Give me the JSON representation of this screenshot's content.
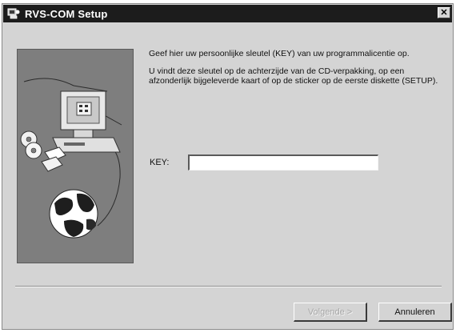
{
  "window": {
    "title": "RVS-COM Setup",
    "close_glyph": "✕",
    "app_icon": "setup-icon"
  },
  "side_panel": {
    "illustration": "computer-cd-globe-illustration"
  },
  "content": {
    "paragraph_1": "Geef hier uw persoonlijke sleutel (KEY) van uw programmalicentie op.",
    "paragraph_2": "U vindt deze sleutel op de achterzijde van de CD-verpakking, op een afzonderlijk bijgeleverde kaart of op de sticker op de eerste diskette (SETUP)."
  },
  "key_field": {
    "label": "KEY:",
    "value": ""
  },
  "buttons": {
    "next": "Volgende >",
    "cancel": "Annuleren"
  }
}
